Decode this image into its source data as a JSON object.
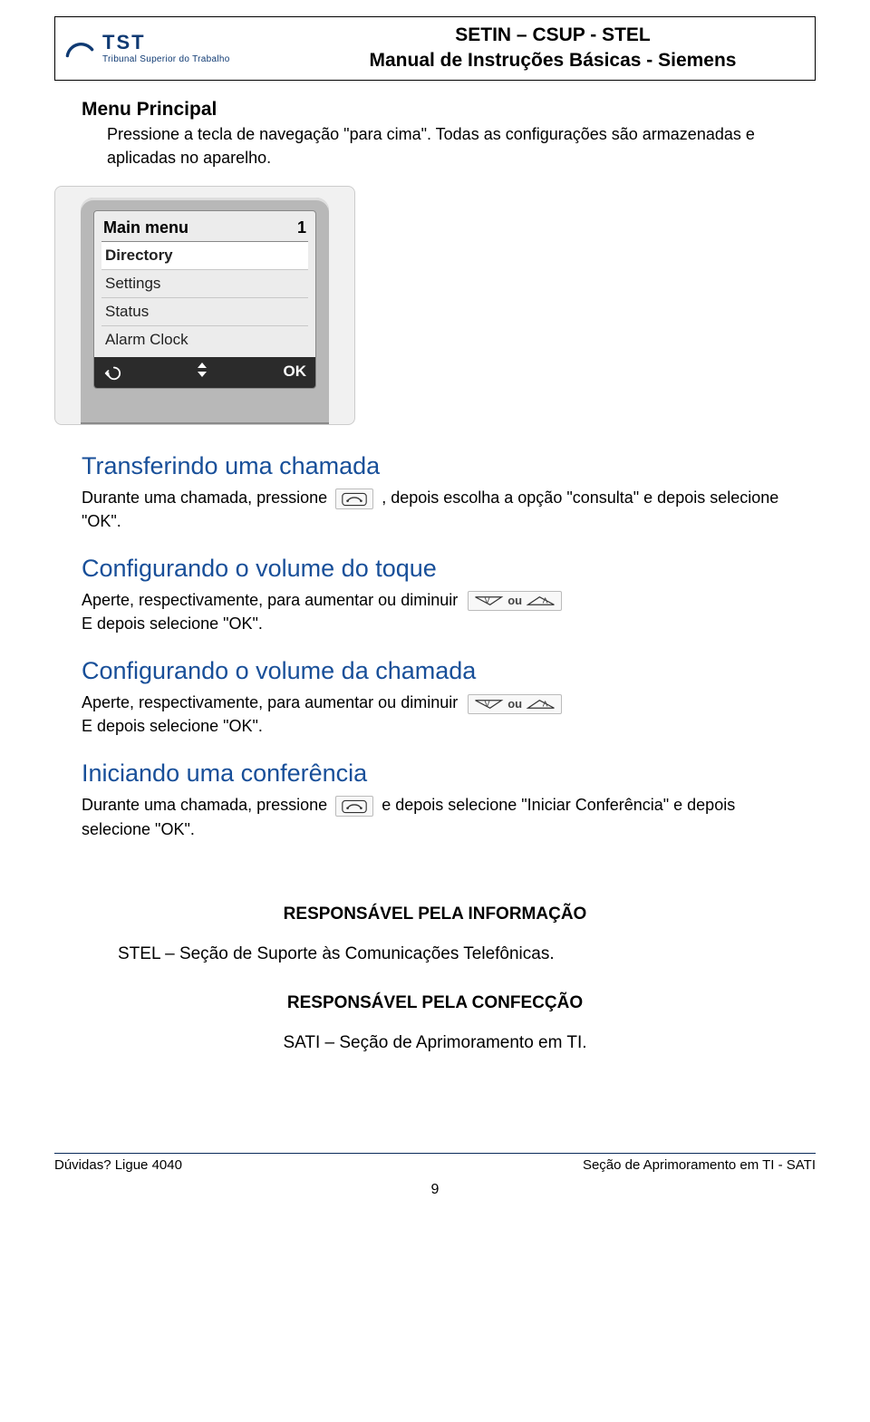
{
  "header": {
    "logo": {
      "main": "TST",
      "sub": "Tribunal Superior do Trabalho"
    },
    "line1": "SETIN – CSUP - STEL",
    "line2": "Manual de Instruções Básicas - Siemens"
  },
  "main_menu": {
    "title": "Menu Principal",
    "body": "Pressione a tecla de navegação \"para cima\". Todas as configurações são armazenadas e aplicadas no aparelho."
  },
  "phone_screen": {
    "head_left": "Main menu",
    "head_right": "1",
    "items": [
      "Directory",
      "Settings",
      "Status",
      "Alarm Clock"
    ],
    "selected_index": 0,
    "footer_ok": "OK"
  },
  "sections": {
    "transfer": {
      "title": "Transferindo uma chamada",
      "pre": "Durante uma chamada, pressione",
      "post": ", depois escolha a opção \"consulta\" e depois selecione \"OK\"."
    },
    "ring_volume": {
      "title": "Configurando o volume do toque",
      "l1": "Aperte, respectivamente, para aumentar ou diminuir",
      "l2": "E depois selecione \"OK\".",
      "ou": "ou"
    },
    "call_volume": {
      "title": "Configurando o volume da chamada",
      "l1": "Aperte, respectivamente, para aumentar ou diminuir",
      "l2": "E depois selecione \"OK\".",
      "ou": "ou"
    },
    "conference": {
      "title": "Iniciando uma conferência",
      "pre": "Durante uma chamada, pressione",
      "post": "e depois selecione \"Iniciar Conferência\" e depois selecione \"OK\"."
    }
  },
  "attribution": {
    "info_label": "RESPONSÁVEL PELA INFORMAÇÃO",
    "info_value": "STEL – Seção de Suporte às Comunicações Telefônicas.",
    "conf_label": "RESPONSÁVEL PELA CONFECÇÃO",
    "conf_value": "SATI – Seção de Aprimoramento em TI."
  },
  "footer": {
    "left": "Dúvidas? Ligue 4040",
    "right": "Seção de Aprimoramento em TI - SATI",
    "page": "9"
  }
}
